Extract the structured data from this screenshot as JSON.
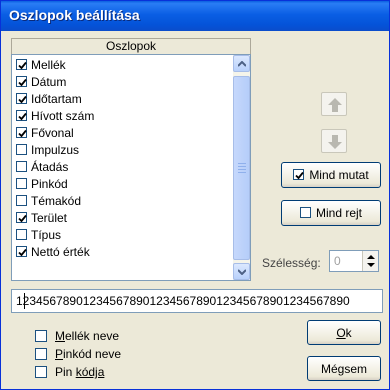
{
  "window": {
    "title": "Oszlopok beállítása"
  },
  "columns": {
    "group_label": "Oszlopok",
    "items": [
      {
        "label": "Mellék",
        "checked": true
      },
      {
        "label": "Dátum",
        "checked": true
      },
      {
        "label": "Időtartam",
        "checked": true
      },
      {
        "label": "Hívott szám",
        "checked": true
      },
      {
        "label": "Fővonal",
        "checked": true
      },
      {
        "label": "Impulzus",
        "checked": false
      },
      {
        "label": "Átadás",
        "checked": false
      },
      {
        "label": "Pinkód",
        "checked": false
      },
      {
        "label": "Témakód",
        "checked": false
      },
      {
        "label": "Terület",
        "checked": true
      },
      {
        "label": "Típus",
        "checked": false
      },
      {
        "label": "Nettó érték",
        "checked": true
      }
    ]
  },
  "buttons": {
    "show_all": "Mind mutat",
    "hide_all": "Mind rejt",
    "ok": "Ok",
    "cancel": "Mégsem"
  },
  "icons": {
    "move_up": "arrow-up-icon",
    "move_down": "arrow-down-icon",
    "checkmark": "checkmark-icon"
  },
  "width": {
    "label": "Szélesség:",
    "value": "0"
  },
  "format_field": {
    "value": "12345678901234567890123456789012345678901234567890"
  },
  "options": [
    {
      "label": "Mellék neve",
      "checked": false
    },
    {
      "label": "Pinkód neve",
      "checked": false
    },
    {
      "label": "Pin kódja",
      "checked": false
    }
  ],
  "colors": {
    "titlebar": "#0a5ee4",
    "dialog_bg": "#ece9d8",
    "button_border": "#003c74",
    "disabled_text": "#a0a0a0"
  }
}
